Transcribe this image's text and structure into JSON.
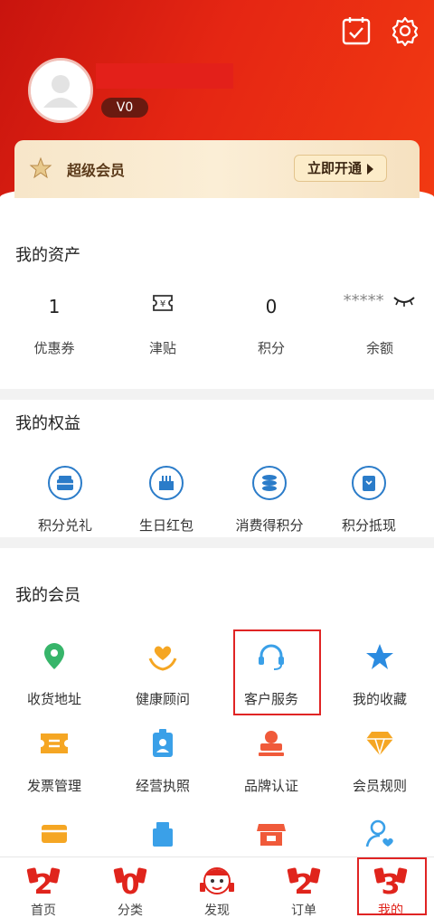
{
  "header": {
    "level": "V0",
    "member_title": "超级会员",
    "join_label": "立即开通"
  },
  "assets": {
    "title": "我的资产",
    "items": [
      {
        "value": "1",
        "label": "优惠券"
      },
      {
        "value": "",
        "label": "津贴",
        "icon": "yen-ticket-icon"
      },
      {
        "value": "0",
        "label": "积分"
      },
      {
        "value": "*****",
        "label": "余额",
        "icon": "eye-closed-icon"
      }
    ]
  },
  "rights": {
    "title": "我的权益",
    "items": [
      {
        "label": "积分兑礼",
        "icon": "points-gift-icon"
      },
      {
        "label": "生日红包",
        "icon": "birthday-cake-icon"
      },
      {
        "label": "消费得积分",
        "icon": "coins-stack-icon"
      },
      {
        "label": "积分抵现",
        "icon": "points-cash-icon"
      }
    ]
  },
  "membership": {
    "title": "我的会员",
    "items": [
      {
        "label": "收货地址",
        "icon": "location-pin-icon"
      },
      {
        "label": "健康顾问",
        "icon": "heart-hands-icon"
      },
      {
        "label": "客户服务",
        "icon": "headset-icon"
      },
      {
        "label": "我的收藏",
        "icon": "star-icon"
      },
      {
        "label": "发票管理",
        "icon": "invoice-icon"
      },
      {
        "label": "经营执照",
        "icon": "license-badge-icon"
      },
      {
        "label": "品牌认证",
        "icon": "brand-stamp-icon"
      },
      {
        "label": "会员规则",
        "icon": "diamond-icon"
      }
    ],
    "partial_row_icons": [
      "card-icon",
      "package-icon",
      "store-icon",
      "user-heart-icon"
    ]
  },
  "bottom_nav": [
    {
      "label": "首页",
      "badge": "2"
    },
    {
      "label": "分类",
      "badge": "0"
    },
    {
      "label": "发现",
      "badge": ""
    },
    {
      "label": "订单",
      "badge": "2"
    },
    {
      "label": "我的",
      "badge": "3"
    }
  ],
  "colors": {
    "header_red": "#e52613",
    "accent_red": "#e02424",
    "blue_icon": "#2b7cc9",
    "orange_icon": "#f5a623",
    "highlight_border": "#e02424"
  }
}
